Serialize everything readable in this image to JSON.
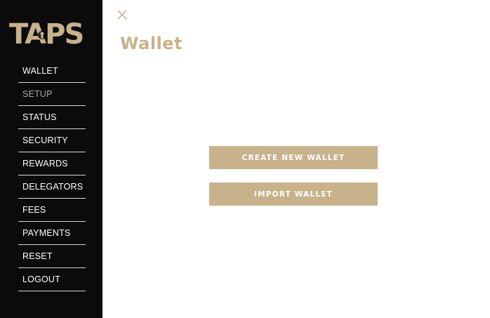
{
  "brand": {
    "logo_text": "TAPS",
    "color": "#c8b28c"
  },
  "sidebar": {
    "background": "#0b0b0b",
    "items": [
      {
        "label": "WALLET",
        "active": false
      },
      {
        "label": "SETUP",
        "active": true
      },
      {
        "label": "STATUS",
        "active": false
      },
      {
        "label": "SECURITY",
        "active": false
      },
      {
        "label": "REWARDS",
        "active": false
      },
      {
        "label": "DELEGATORS",
        "active": false
      },
      {
        "label": "FEES",
        "active": false
      },
      {
        "label": "PAYMENTS",
        "active": false
      },
      {
        "label": "RESET",
        "active": false
      },
      {
        "label": "LOGOUT",
        "active": false
      }
    ]
  },
  "header": {
    "close_icon": "close-icon",
    "title": "Wallet"
  },
  "main": {
    "create_wallet_label": "CREATE NEW WALLET",
    "import_wallet_label": "IMPORT WALLET"
  },
  "colors": {
    "accent": "#c8b28c",
    "sidebar_text": "#ffffff",
    "sidebar_active_text": "#a9a9a9"
  }
}
